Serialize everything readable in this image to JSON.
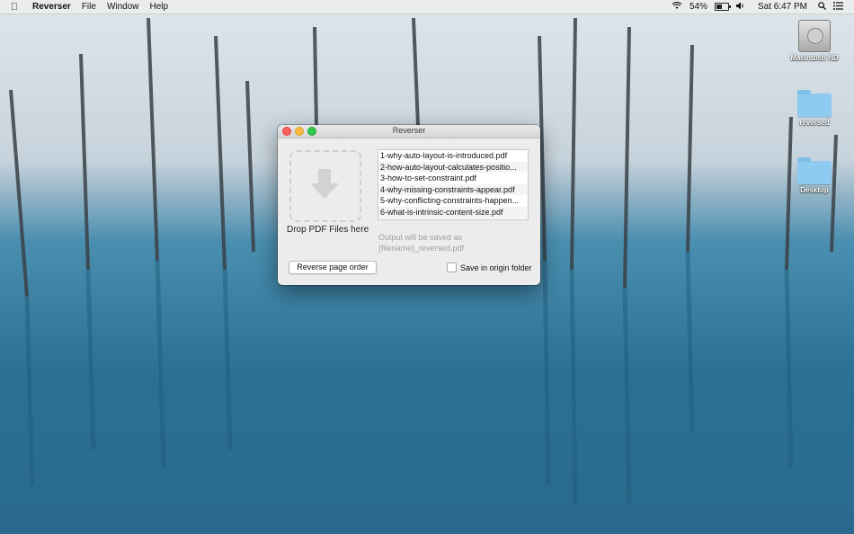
{
  "menubar": {
    "app_name": "Reverser",
    "menus": [
      "File",
      "Window",
      "Help"
    ],
    "battery": "54%",
    "battery_level": 0.54,
    "clock": "Sat 6:47 PM"
  },
  "desktop_icons": [
    {
      "label": "Macintosh HD",
      "icon": "hard-drive-icon"
    },
    {
      "label": "reversed",
      "icon": "folder-icon"
    },
    {
      "label": "Desktop",
      "icon": "folder-icon"
    }
  ],
  "window": {
    "title": "Reverser",
    "drop_label": "Drop PDF Files here",
    "files": [
      "1-why-auto-layout-is-introduced.pdf",
      "2-how-auto-layout-calculates-positio...",
      "3-how-to-set-constraint.pdf",
      "4-why-missing-constraints-appear.pdf",
      "5-why-conflicting-constraints-happen...",
      "6-what-is-intrinsic-content-size.pdf"
    ],
    "output_note_line1": "Output will be saved as",
    "output_note_line2": "(filename)_reversed.pdf",
    "reverse_button": "Reverse page order",
    "save_option": "Save in origin folder",
    "save_option_checked": false
  }
}
